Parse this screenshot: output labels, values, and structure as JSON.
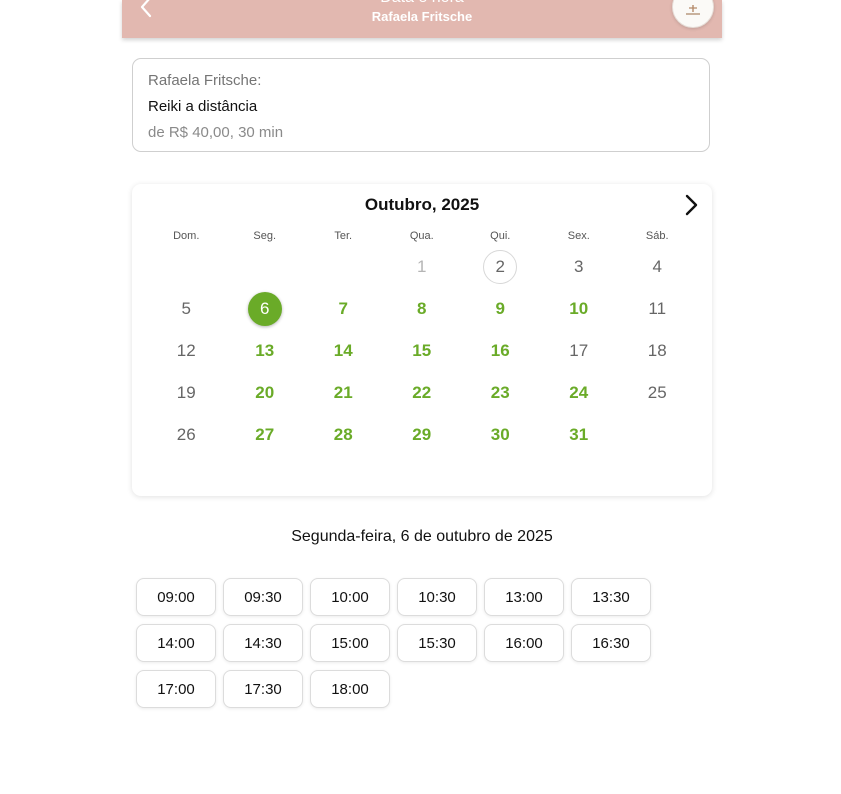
{
  "header": {
    "title": "Data e hora",
    "subtitle": "Rafaela Fritsche",
    "back_icon": "chevron-left-icon",
    "avatar_icon": "profile-logo"
  },
  "service": {
    "provider": "Rafaela Fritsche:",
    "name": "Reiki a distância",
    "price": "de R$ 40,00, 30 min"
  },
  "calendar": {
    "month_label": "Outubro, 2025",
    "next_icon": "chevron-right-icon",
    "weekdays": [
      "Dom.",
      "Seg.",
      "Ter.",
      "Qua.",
      "Qui.",
      "Sex.",
      "Sáb."
    ],
    "days": [
      {
        "label": "",
        "state": "empty"
      },
      {
        "label": "",
        "state": "empty"
      },
      {
        "label": "",
        "state": "empty"
      },
      {
        "label": "1",
        "state": "disabled"
      },
      {
        "label": "2",
        "state": "today"
      },
      {
        "label": "3",
        "state": "normal"
      },
      {
        "label": "4",
        "state": "normal"
      },
      {
        "label": "5",
        "state": "normal"
      },
      {
        "label": "6",
        "state": "selected"
      },
      {
        "label": "7",
        "state": "available"
      },
      {
        "label": "8",
        "state": "available"
      },
      {
        "label": "9",
        "state": "available"
      },
      {
        "label": "10",
        "state": "available"
      },
      {
        "label": "11",
        "state": "normal"
      },
      {
        "label": "12",
        "state": "normal"
      },
      {
        "label": "13",
        "state": "available"
      },
      {
        "label": "14",
        "state": "available"
      },
      {
        "label": "15",
        "state": "available"
      },
      {
        "label": "16",
        "state": "available"
      },
      {
        "label": "17",
        "state": "normal"
      },
      {
        "label": "18",
        "state": "normal"
      },
      {
        "label": "19",
        "state": "normal"
      },
      {
        "label": "20",
        "state": "available"
      },
      {
        "label": "21",
        "state": "available"
      },
      {
        "label": "22",
        "state": "available"
      },
      {
        "label": "23",
        "state": "available"
      },
      {
        "label": "24",
        "state": "available"
      },
      {
        "label": "25",
        "state": "normal"
      },
      {
        "label": "26",
        "state": "normal"
      },
      {
        "label": "27",
        "state": "available"
      },
      {
        "label": "28",
        "state": "available"
      },
      {
        "label": "29",
        "state": "available"
      },
      {
        "label": "30",
        "state": "available"
      },
      {
        "label": "31",
        "state": "available"
      }
    ]
  },
  "selected_date_label": "Segunda-feira, 6 de outubro de 2025",
  "time_slots": [
    "09:00",
    "09:30",
    "10:00",
    "10:30",
    "13:00",
    "13:30",
    "14:00",
    "14:30",
    "15:00",
    "15:30",
    "16:00",
    "16:30",
    "17:00",
    "17:30",
    "18:00"
  ],
  "colors": {
    "header_bg": "#e2b8b0",
    "accent_green": "#6aab28"
  }
}
